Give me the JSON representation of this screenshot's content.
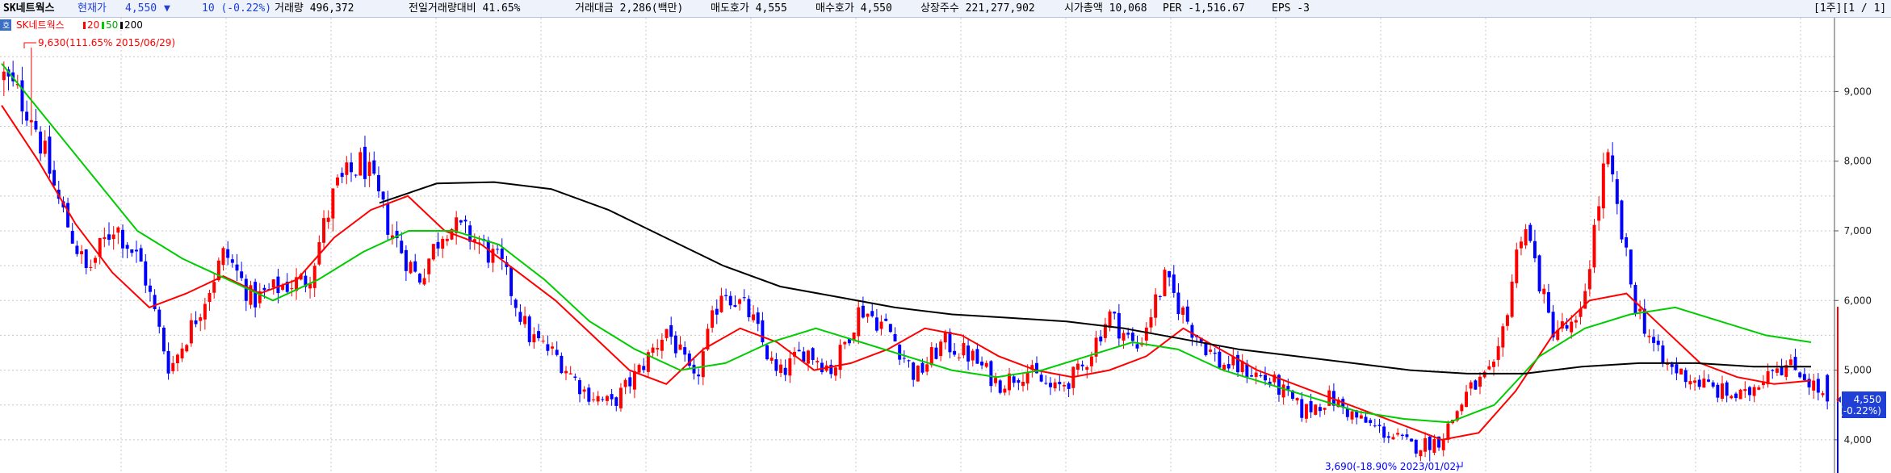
{
  "header": {
    "stock_name": "SK네트웍스",
    "price_type": "현재가",
    "price": "4,550",
    "change_arrow": "▼",
    "change": "10 (-0.22%)",
    "volume": "거래량 496,372",
    "prev_volume_ratio": "전일거래량대비 41.65%",
    "trade_amount": "거래대금 2,286(백만)",
    "ask": "매도호가 4,555",
    "bid": "매수호가 4,550",
    "listed_shares": "상장주수 221,277,902",
    "market_cap": "시가총액 10,068",
    "per": "PER -1,516.67",
    "eps": "EPS -3",
    "page_indicator": "[1주][1 / 1]"
  },
  "colors": {
    "up": "#ff0000",
    "down": "#0000ff",
    "ma20": "#ff0000",
    "ma50": "#00cc00",
    "ma200": "#000000",
    "highlight_price": "#1f3fd6"
  },
  "chart_data": {
    "type": "line",
    "subtype": "candlestick",
    "ylim": [
      3700,
      9900
    ],
    "yticks": [
      {
        "value": 4000,
        "label": "4,000"
      },
      {
        "value": 5000,
        "label": "5,000"
      },
      {
        "value": 6000,
        "label": "6,000"
      },
      {
        "value": 7000,
        "label": "7,000"
      },
      {
        "value": 8000,
        "label": "8,000"
      },
      {
        "value": 9000,
        "label": "9,000"
      }
    ],
    "legend": {
      "name": "SK네트웍스",
      "items": [
        "20",
        "50",
        "200"
      ]
    },
    "max_label": "9,630(111.65% 2015/06/29)",
    "max_value": 9630,
    "min_label": "3,690(-18.90% 2023/01/02)",
    "min_value": 3690,
    "current_value": 4550,
    "current_label": "4,550",
    "current_change": "(-0.22%)",
    "grid": true,
    "anchors": [
      9200,
      8700,
      7400,
      6400,
      7100,
      6500,
      5000,
      5800,
      6700,
      6000,
      6200,
      6300,
      7600,
      8000,
      7000,
      6300,
      7100,
      6900,
      6500,
      5500,
      5200,
      4700,
      4500,
      5000,
      5600,
      4800,
      6200,
      5800,
      4900,
      5300,
      5000,
      5900,
      5600,
      4900,
      5400,
      5200,
      4800,
      5000,
      4700,
      5000,
      5800,
      5300,
      6300,
      5600,
      5100,
      5000,
      4800,
      4400,
      4600,
      4300,
      4100,
      3900,
      4000,
      4700,
      5000,
      7200,
      5600,
      5600,
      8100,
      6000,
      5100,
      4900,
      4700,
      4600,
      5100,
      5000,
      4550
    ],
    "ma_series": [
      {
        "name": "20",
        "color": "#ff0000",
        "values": [
          8800,
          8000,
          7100,
          6400,
          5900,
          6100,
          6350,
          6100,
          6300,
          6900,
          7300,
          7500,
          7000,
          6800,
          6400,
          6000,
          5500,
          5000,
          4800,
          5300,
          5600,
          5400,
          5000,
          5100,
          5300,
          5600,
          5500,
          5200,
          5000,
          4900,
          5000,
          5200,
          5600,
          5300,
          5000,
          4800,
          4600,
          4400,
          4200,
          4000,
          4100,
          4700,
          5500,
          6000,
          6100,
          5600,
          5100,
          4900,
          4800,
          4850
        ]
      },
      {
        "name": "50",
        "color": "#00cc00",
        "values": [
          9400,
          8600,
          7800,
          7000,
          6600,
          6300,
          6000,
          6300,
          6700,
          7000,
          7000,
          6800,
          6300,
          5700,
          5300,
          5000,
          5100,
          5400,
          5600,
          5400,
          5200,
          5000,
          4900,
          5000,
          5200,
          5400,
          5300,
          5000,
          4800,
          4600,
          4400,
          4300,
          4250,
          4500,
          5200,
          5600,
          5800,
          5900,
          5700,
          5500,
          5400
        ]
      },
      {
        "name": "200",
        "color": "#000000",
        "values": [
          7400,
          7680,
          7700,
          7600,
          7300,
          6900,
          6500,
          6200,
          6050,
          5900,
          5800,
          5750,
          5700,
          5600,
          5450,
          5300,
          5200,
          5100,
          5000,
          4950,
          4950,
          5050,
          5100,
          5100,
          5050,
          5050
        ]
      }
    ]
  }
}
